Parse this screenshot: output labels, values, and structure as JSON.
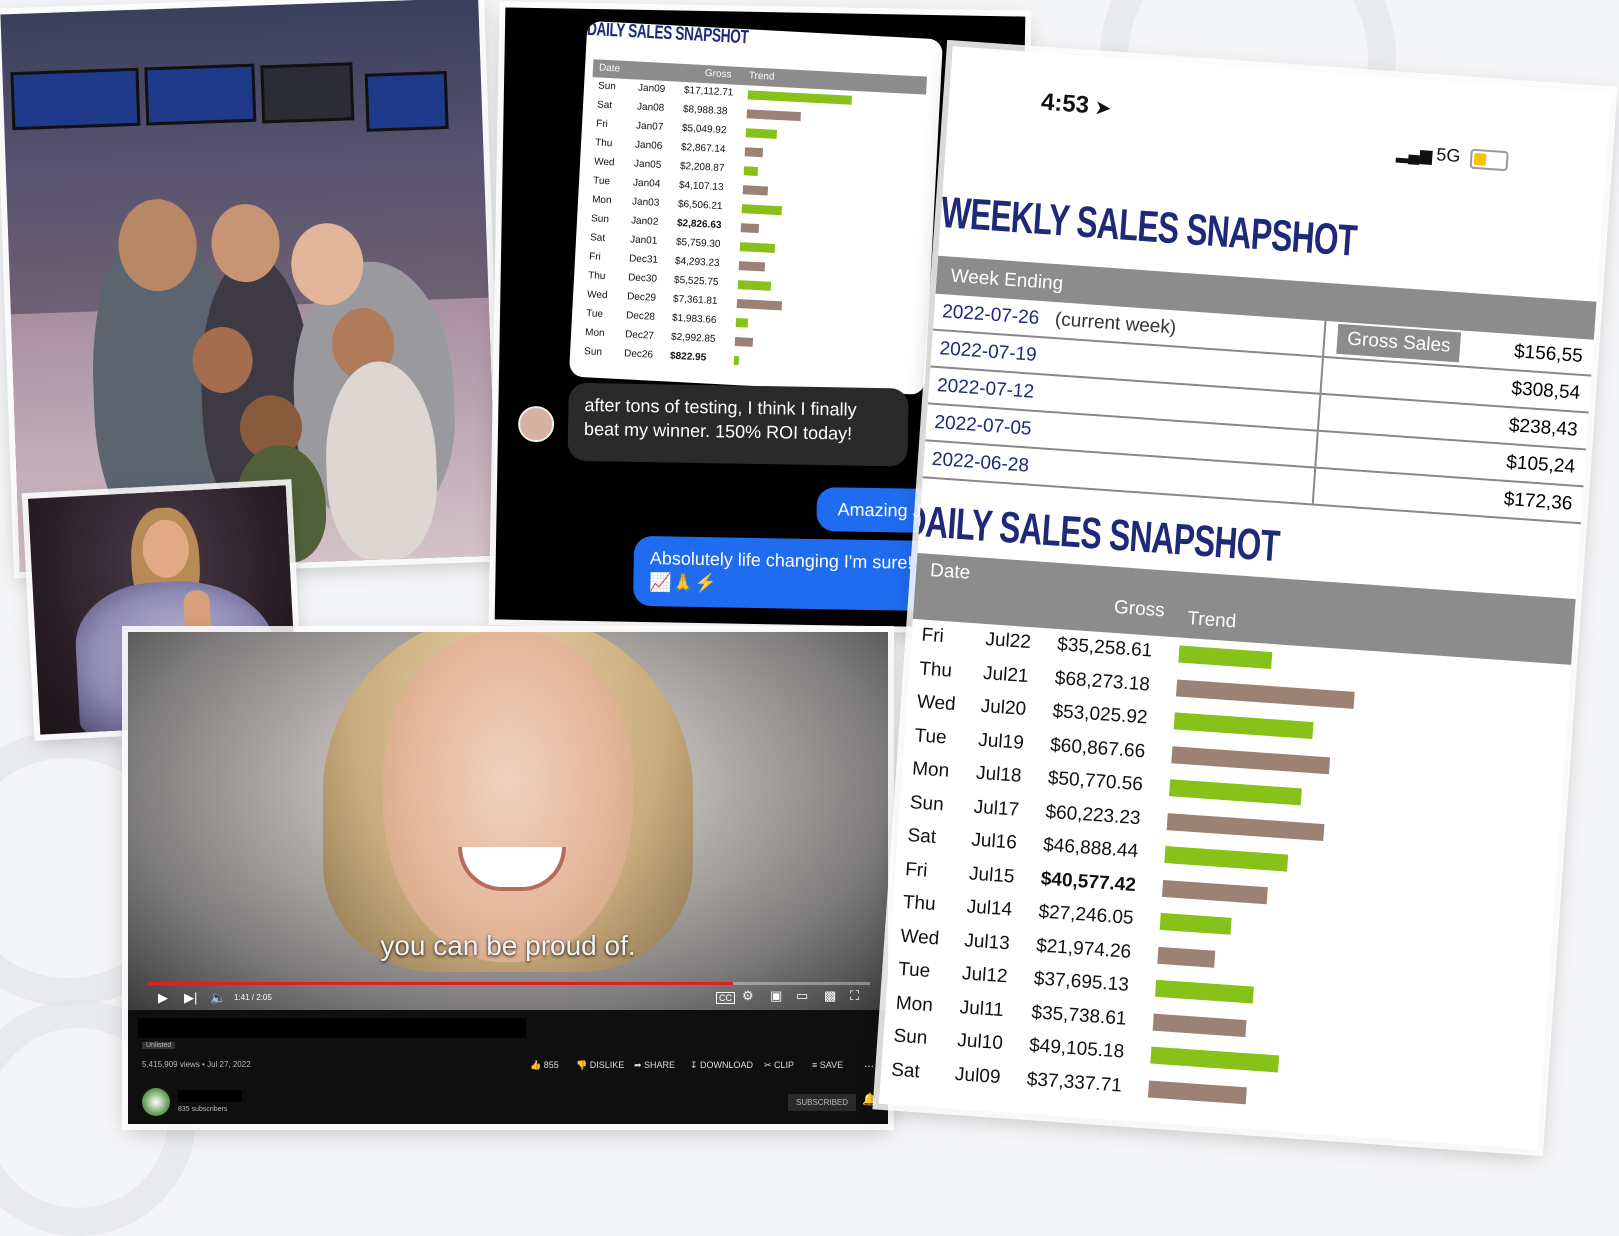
{
  "chat": {
    "card_title": "DAILY SALES SNAPSHOT",
    "columns": {
      "date": "Date",
      "gross": "Gross",
      "trend": "Trend"
    },
    "rows": [
      {
        "day": "Sun",
        "date": "Jan09",
        "gross": "$17,112.71",
        "trend": 1.0,
        "color": "green"
      },
      {
        "day": "Sat",
        "date": "Jan08",
        "gross": "$8,988.38",
        "trend": 0.52,
        "color": "brown"
      },
      {
        "day": "Fri",
        "date": "Jan07",
        "gross": "$5,049.92",
        "trend": 0.3,
        "color": "green"
      },
      {
        "day": "Thu",
        "date": "Jan06",
        "gross": "$2,867.14",
        "trend": 0.17,
        "color": "brown"
      },
      {
        "day": "Wed",
        "date": "Jan05",
        "gross": "$2,208.87",
        "trend": 0.13,
        "color": "green"
      },
      {
        "day": "Tue",
        "date": "Jan04",
        "gross": "$4,107.13",
        "trend": 0.24,
        "color": "brown"
      },
      {
        "day": "Mon",
        "date": "Jan03",
        "gross": "$6,506.21",
        "trend": 0.38,
        "color": "green"
      },
      {
        "day": "Sun",
        "date": "Jan02",
        "gross": "$2,826.63",
        "trend": 0.17,
        "color": "brown",
        "bold": true
      },
      {
        "day": "Sat",
        "date": "Jan01",
        "gross": "$5,759.30",
        "trend": 0.34,
        "color": "green"
      },
      {
        "day": "Fri",
        "date": "Dec31",
        "gross": "$4,293.23",
        "trend": 0.25,
        "color": "brown"
      },
      {
        "day": "Thu",
        "date": "Dec30",
        "gross": "$5,525.75",
        "trend": 0.32,
        "color": "green"
      },
      {
        "day": "Wed",
        "date": "Dec29",
        "gross": "$7,361.81",
        "trend": 0.43,
        "color": "brown"
      },
      {
        "day": "Tue",
        "date": "Dec28",
        "gross": "$1,983.66",
        "trend": 0.12,
        "color": "green"
      },
      {
        "day": "Mon",
        "date": "Dec27",
        "gross": "$2,992.85",
        "trend": 0.17,
        "color": "brown"
      },
      {
        "day": "Sun",
        "date": "Dec26",
        "gross": "$822.95",
        "trend": 0.05,
        "color": "green",
        "bold": true
      }
    ],
    "msg_in": "after tons of testing, I think I finally beat my winner. 150% ROI today!",
    "msg_out_1": "Amazing Jen!!",
    "msg_out_2": "Absolutely life changing I'm sure!",
    "msg_out_2_emoji": "📈🙏⚡"
  },
  "phone": {
    "time": "4:53",
    "network": "5G",
    "weekly_title": "WEEKLY SALES SNAPSHOT",
    "weekly_head_date": "Week Ending",
    "weekly_head_gross": "Gross Sales",
    "weekly_rows": [
      {
        "date": "2022-07-26",
        "note": "(current week)",
        "gross": "$156,55"
      },
      {
        "date": "2022-07-19",
        "note": "",
        "gross": "$308,54"
      },
      {
        "date": "2022-07-12",
        "note": "",
        "gross": "$238,43"
      },
      {
        "date": "2022-07-05",
        "note": "",
        "gross": "$105,24"
      },
      {
        "date": "2022-06-28",
        "note": "",
        "gross": "$172,36"
      }
    ],
    "daily_title": "DAILY SALES SNAPSHOT",
    "daily_head": {
      "date": "Date",
      "gross": "Gross",
      "trend": "Trend"
    },
    "daily_rows": [
      {
        "day": "Fri",
        "date": "Jul22",
        "gross": "$35,258.61",
        "trend": 0.52,
        "color": "green"
      },
      {
        "day": "Thu",
        "date": "Jul21",
        "gross": "$68,273.18",
        "trend": 1.0,
        "color": "brown"
      },
      {
        "day": "Wed",
        "date": "Jul20",
        "gross": "$53,025.92",
        "trend": 0.78,
        "color": "green"
      },
      {
        "day": "Tue",
        "date": "Jul19",
        "gross": "$60,867.66",
        "trend": 0.89,
        "color": "brown"
      },
      {
        "day": "Mon",
        "date": "Jul18",
        "gross": "$50,770.56",
        "trend": 0.74,
        "color": "green"
      },
      {
        "day": "Sun",
        "date": "Jul17",
        "gross": "$60,223.23",
        "trend": 0.88,
        "color": "brown"
      },
      {
        "day": "Sat",
        "date": "Jul16",
        "gross": "$46,888.44",
        "trend": 0.69,
        "color": "green"
      },
      {
        "day": "Fri",
        "date": "Jul15",
        "gross": "$40,577.42",
        "trend": 0.59,
        "color": "brown",
        "bold": true
      },
      {
        "day": "Thu",
        "date": "Jul14",
        "gross": "$27,246.05",
        "trend": 0.4,
        "color": "green"
      },
      {
        "day": "Wed",
        "date": "Jul13",
        "gross": "$21,974.26",
        "trend": 0.32,
        "color": "brown"
      },
      {
        "day": "Tue",
        "date": "Jul12",
        "gross": "$37,695.13",
        "trend": 0.55,
        "color": "green"
      },
      {
        "day": "Mon",
        "date": "Jul11",
        "gross": "$35,738.61",
        "trend": 0.52,
        "color": "brown"
      },
      {
        "day": "Sun",
        "date": "Jul10",
        "gross": "$49,105.18",
        "trend": 0.72,
        "color": "green"
      },
      {
        "day": "Sat",
        "date": "Jul09",
        "gross": "$37,337.71",
        "trend": 0.55,
        "color": "brown"
      }
    ]
  },
  "video": {
    "caption": "you can be proud of.",
    "time": "1:41 / 2:05",
    "progress": 0.81,
    "unlisted": "Unlisted",
    "views": "5,415,909 views • Jul 27, 2022",
    "likes": "855",
    "dislike": "DISLIKE",
    "share": "SHARE",
    "download": "DOWNLOAD",
    "clip": "CLIP",
    "save": "SAVE",
    "more": "...",
    "subscribers": "835 subscribers",
    "subscribed": "SUBSCRIBED"
  },
  "colors": {
    "green": "#86c21a",
    "brown": "#9b8275",
    "navy": "#1e2a78",
    "header_gray": "#8c8c8c",
    "bubble_blue": "#1f6cf0"
  }
}
